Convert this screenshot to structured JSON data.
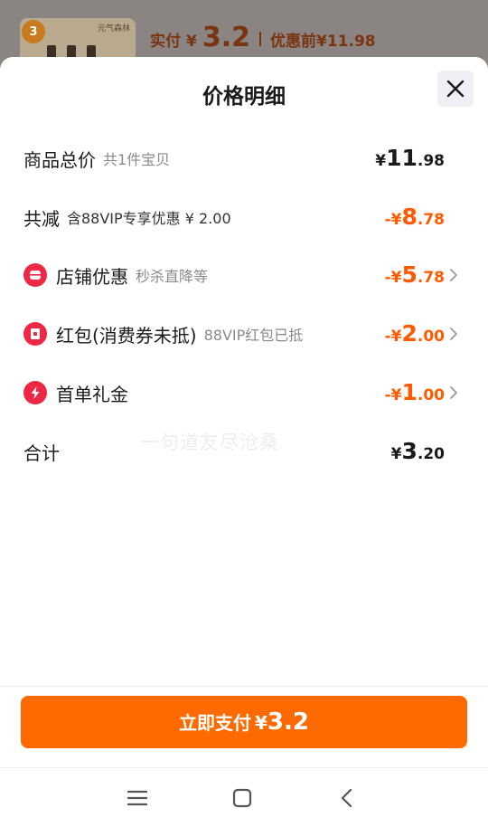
{
  "backdrop": {
    "thumb_badge": "3",
    "thumb_brand": "元气森林",
    "pay_label": "实付",
    "yen": "¥",
    "pay_amount": "3.2",
    "before_label": "优惠前",
    "before_amount": "¥11.98"
  },
  "sheet": {
    "title": "价格明细"
  },
  "rows": [
    {
      "label": "商品总价",
      "sub": "共1件宝贝",
      "prefix": "¥",
      "int": "11",
      "dec": ".98"
    },
    {
      "label": "共减",
      "sub": "含88VIP专享优惠 ¥ 2.00",
      "prefix": "-¥",
      "int": "8",
      "dec": ".78"
    },
    {
      "label": "店铺优惠",
      "sub": "秒杀直降等",
      "prefix": "-¥",
      "int": "5",
      "dec": ".78",
      "icon": "shop-icon"
    },
    {
      "label": "红包(消费券未抵)",
      "sub": "88VIP红包已抵",
      "prefix": "-¥",
      "int": "2",
      "dec": ".00",
      "icon": "red-packet-icon"
    },
    {
      "label": "首单礼金",
      "sub": "",
      "prefix": "-¥",
      "int": "1",
      "dec": ".00",
      "icon": "lightning-icon"
    },
    {
      "label": "合计",
      "sub": "",
      "prefix": "¥",
      "int": "3",
      "dec": ".20"
    }
  ],
  "pay_button": {
    "label": "立即支付",
    "yen": "¥",
    "amount": "3.2"
  },
  "watermark": "一句道友尽沧桑",
  "colors": {
    "accent_orange": "#ff6a00",
    "discount_orange": "#ff5a00",
    "icon_red": "#ee2744"
  }
}
